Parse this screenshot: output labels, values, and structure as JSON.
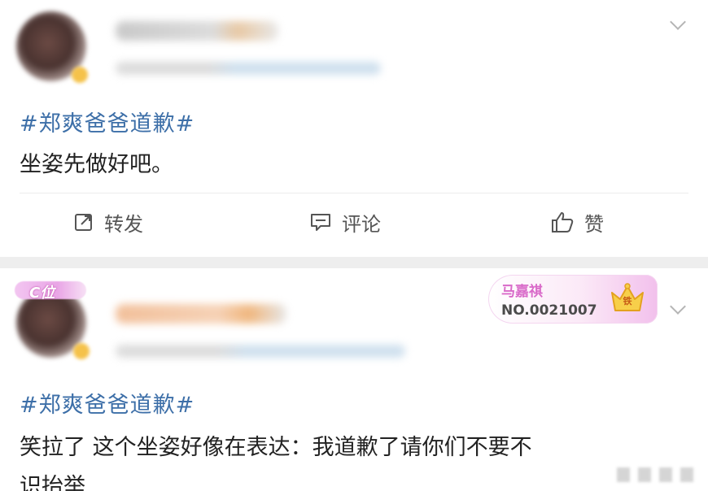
{
  "post1": {
    "topic": "#郑爽爸爸道歉#",
    "content": "坐姿先做好吧。",
    "actions": {
      "repost": "转发",
      "comment": "评论",
      "like": "赞"
    }
  },
  "post2": {
    "badge": "C位",
    "fan_card": {
      "name": "马嘉祺",
      "number": "NO.0021007",
      "level": "铁"
    },
    "topic": "#郑爽爸爸道歉#",
    "content_line1": "笑拉了 这个坐姿好像在表达：我道歉了请你们不要不",
    "content_line2": "识抬举"
  },
  "colors": {
    "topic_blue": "#3d6fa8",
    "separator_gray": "#eeeeee",
    "text": "#222222"
  }
}
